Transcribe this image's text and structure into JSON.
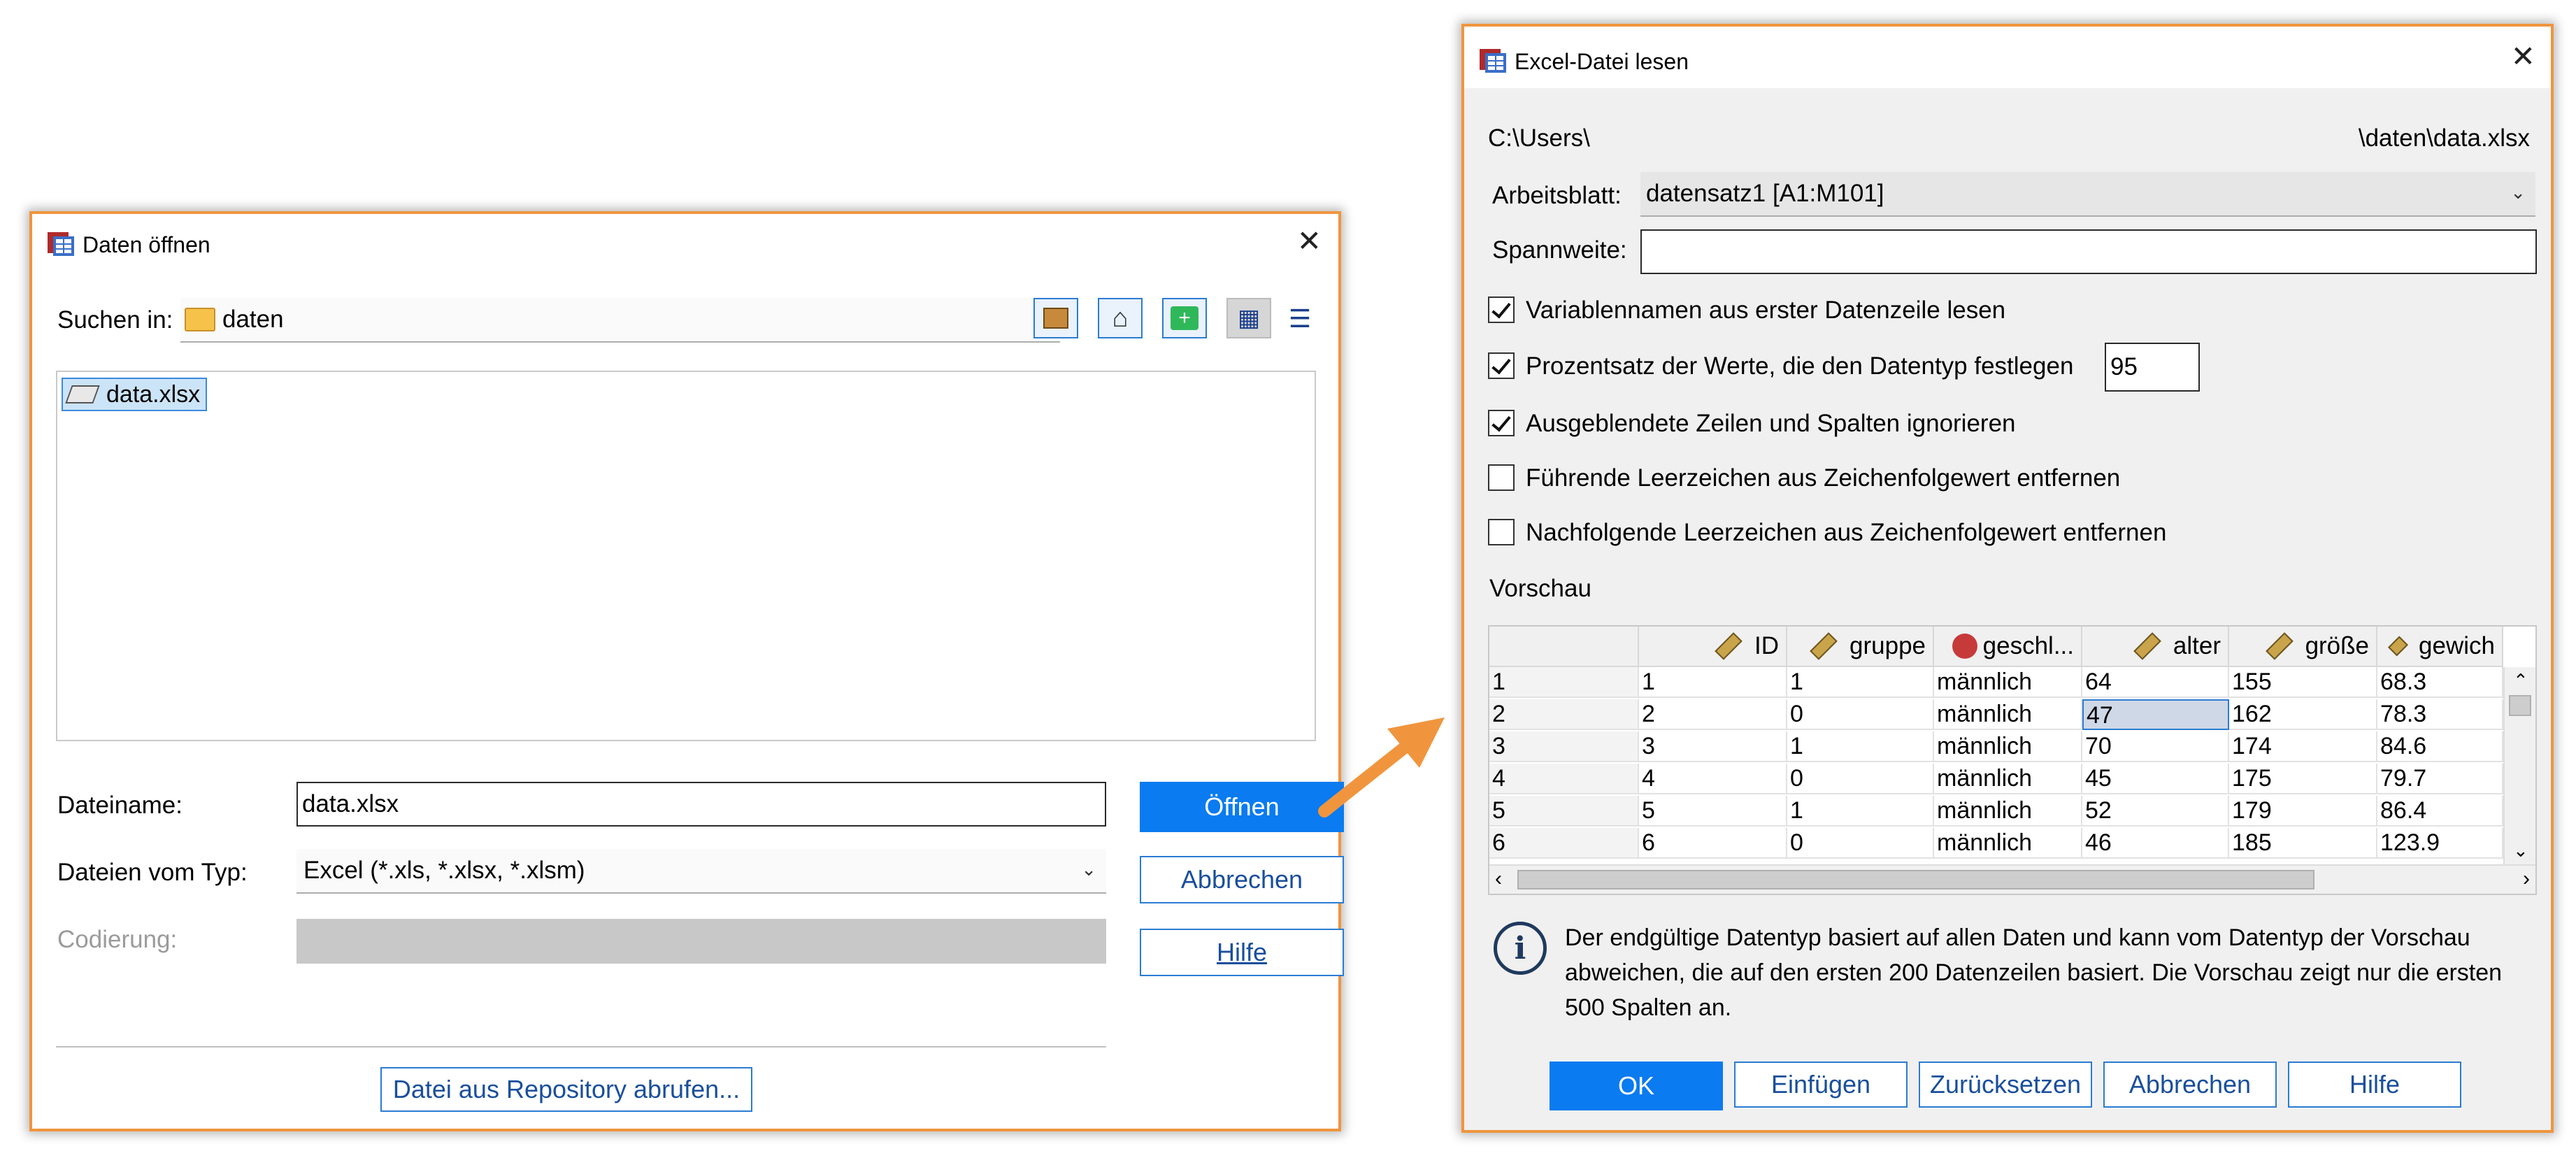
{
  "open_dialog": {
    "title": "Daten öffnen",
    "look_in_label": "Suchen in:",
    "look_in_value": "daten",
    "files": [
      {
        "name": "data.xlsx"
      }
    ],
    "filename_label": "Dateiname:",
    "filename_value": "data.xlsx",
    "filetype_label": "Dateien vom Typ:",
    "filetype_value": "Excel (*.xls, *.xlsx, *.xlsm)",
    "encoding_label": "Codierung:",
    "buttons": {
      "open": "Öffnen",
      "cancel": "Abbrechen",
      "help": "Hilfe"
    },
    "repository_button": "Datei aus Repository abrufen..."
  },
  "excel_dialog": {
    "title": "Excel-Datei lesen",
    "path_left": "C:\\Users\\",
    "path_right": "\\daten\\data.xlsx",
    "worksheet_label": "Arbeitsblatt:",
    "worksheet_value": "datensatz1 [A1:M101]",
    "range_label": "Spannweite:",
    "range_value": "",
    "options": [
      {
        "label": "Variablennamen aus erster Datenzeile lesen",
        "checked": true
      },
      {
        "label": "Prozentsatz der Werte, die den Datentyp festlegen",
        "checked": true
      },
      {
        "label": "Ausgeblendete Zeilen und Spalten ignorieren",
        "checked": true
      },
      {
        "label": "Führende Leerzeichen aus Zeichenfolgewert entfernen",
        "checked": false
      },
      {
        "label": "Nachfolgende Leerzeichen aus Zeichenfolgewert entfernen",
        "checked": false
      }
    ],
    "percent_value": "95",
    "preview_label": "Vorschau",
    "preview": {
      "columns": [
        "ID",
        "gruppe",
        "geschl...",
        "alter",
        "größe",
        "gewich"
      ],
      "rows": [
        [
          "1",
          "1",
          "1",
          "männlich",
          "64",
          "155",
          "68.3"
        ],
        [
          "2",
          "2",
          "0",
          "männlich",
          "47",
          "162",
          "78.3"
        ],
        [
          "3",
          "3",
          "1",
          "männlich",
          "70",
          "174",
          "84.6"
        ],
        [
          "4",
          "4",
          "0",
          "männlich",
          "45",
          "175",
          "79.7"
        ],
        [
          "5",
          "5",
          "1",
          "männlich",
          "52",
          "179",
          "86.4"
        ],
        [
          "6",
          "6",
          "0",
          "männlich",
          "46",
          "185",
          "123.9"
        ]
      ]
    },
    "info_text": "Der endgültige Datentyp basiert auf allen Daten und kann vom Datentyp der Vorschau abweichen, die auf den ersten 200 Datenzeilen basiert. Die Vorschau zeigt nur die ersten 500 Spalten an.",
    "buttons": {
      "ok": "OK",
      "paste": "Einfügen",
      "reset": "Zurücksetzen",
      "cancel": "Abbrechen",
      "help": "Hilfe"
    }
  },
  "colors": {
    "accent_border": "#f0953e",
    "primary_button": "#0a7bf0",
    "arrow": "#f0953e"
  }
}
